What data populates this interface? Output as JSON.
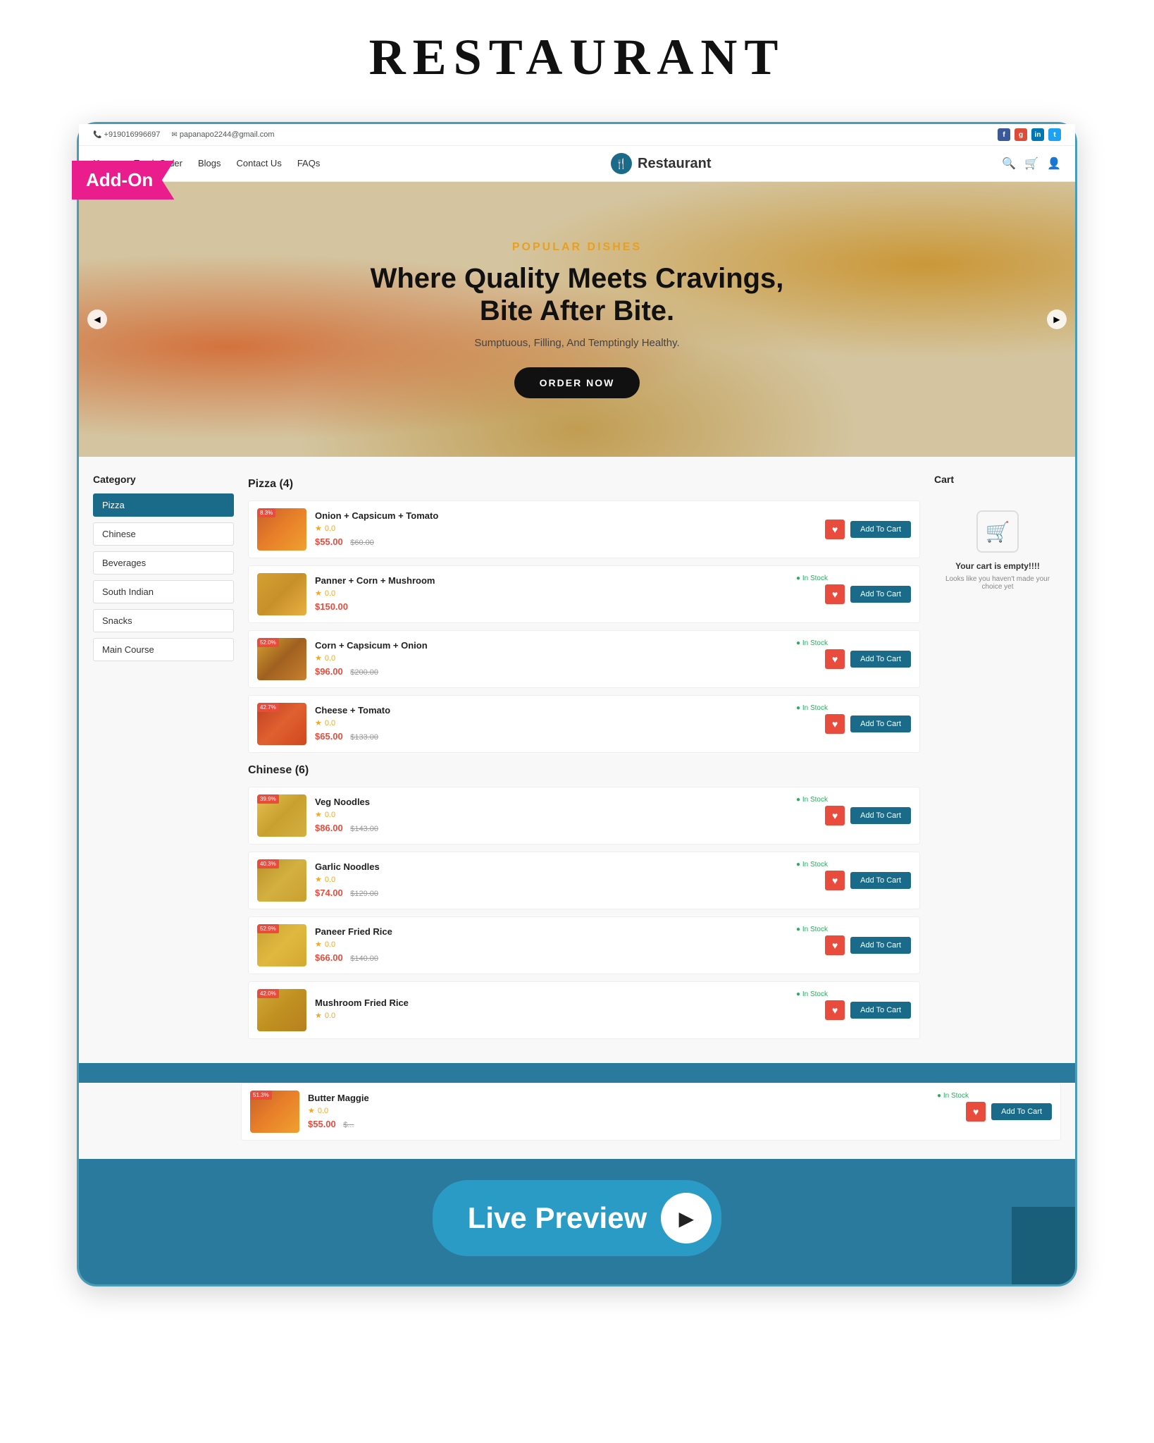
{
  "page": {
    "title": "RESTAURANT",
    "addon_label": "Add-On"
  },
  "topbar": {
    "phone": "+919016996697",
    "email": "papanapo2244@gmail.com",
    "socials": [
      "f",
      "g+",
      "in",
      "t"
    ]
  },
  "nav": {
    "links": [
      "Home",
      "Track Order",
      "Blogs",
      "Contact Us",
      "FAQs"
    ],
    "active": "Home",
    "logo": "Restaurant"
  },
  "hero": {
    "subtitle": "POPULAR DISHES",
    "title_line1": "Where Quality Meets Cravings,",
    "title_line2": "Bite After Bite.",
    "description": "Sumptuous, Filling, And Temptingly Healthy.",
    "button": "ORDER NOW"
  },
  "sidebar": {
    "title": "Category",
    "categories": [
      "Pizza",
      "Chinese",
      "Beverages",
      "South Indian",
      "Snacks",
      "Main Course"
    ]
  },
  "sections": [
    {
      "name": "Pizza (4)",
      "products": [
        {
          "name": "Onion + Capsicum + Tomato",
          "rating": "0.0",
          "price": "$55.00",
          "old_price": "$60.00",
          "badge": "8.3%",
          "in_stock": "",
          "img_class": "food-img-1"
        },
        {
          "name": "Panner + Corn + Mushroom",
          "rating": "0.0",
          "price": "$150.00",
          "old_price": "",
          "badge": "",
          "in_stock": "In Stock",
          "img_class": "food-img-2"
        },
        {
          "name": "Corn + Capsicum + Onion",
          "rating": "0.0",
          "price": "$96.00",
          "old_price": "$200.00",
          "badge": "52.0%",
          "in_stock": "In Stock",
          "img_class": "food-img-3"
        },
        {
          "name": "Cheese + Tomato",
          "rating": "0.0",
          "price": "$65.00",
          "old_price": "$133.00",
          "badge": "42.7%",
          "in_stock": "In Stock",
          "img_class": "food-img-4"
        }
      ]
    },
    {
      "name": "Chinese (6)",
      "products": [
        {
          "name": "Veg Noodles",
          "rating": "0.0",
          "price": "$86.00",
          "old_price": "$143.00",
          "badge": "39.9%",
          "in_stock": "In Stock",
          "img_class": "food-img-5"
        },
        {
          "name": "Garlic Noodles",
          "rating": "0.0",
          "price": "$74.00",
          "old_price": "$129.00",
          "badge": "40.3%",
          "in_stock": "In Stock",
          "img_class": "food-img-6"
        },
        {
          "name": "Paneer Fried Rice",
          "rating": "0.0",
          "price": "$66.00",
          "old_price": "$140.00",
          "badge": "52.9%",
          "in_stock": "In Stock",
          "img_class": "food-img-7"
        },
        {
          "name": "Mushroom Fried Rice",
          "rating": "0.0",
          "price": "",
          "old_price": "",
          "badge": "42.0%",
          "in_stock": "In Stock",
          "img_class": "food-img-8"
        }
      ]
    }
  ],
  "partial_sections": [
    {
      "name": "Butter Maggie",
      "rating": "0.0",
      "price": "$55.00",
      "old_price": "$...",
      "badge": "51.3%",
      "in_stock": "In Stock",
      "img_class": "food-img-1"
    }
  ],
  "cart": {
    "title": "Cart",
    "empty_title": "Your cart is empty!!!!",
    "empty_sub": "Looks like you haven't made your choice yet"
  },
  "live_preview": {
    "label": "Live Preview",
    "arrow": "▶"
  },
  "buttons": {
    "add_to_cart": "Add To Cart",
    "order_now": "ORDER NOW"
  }
}
